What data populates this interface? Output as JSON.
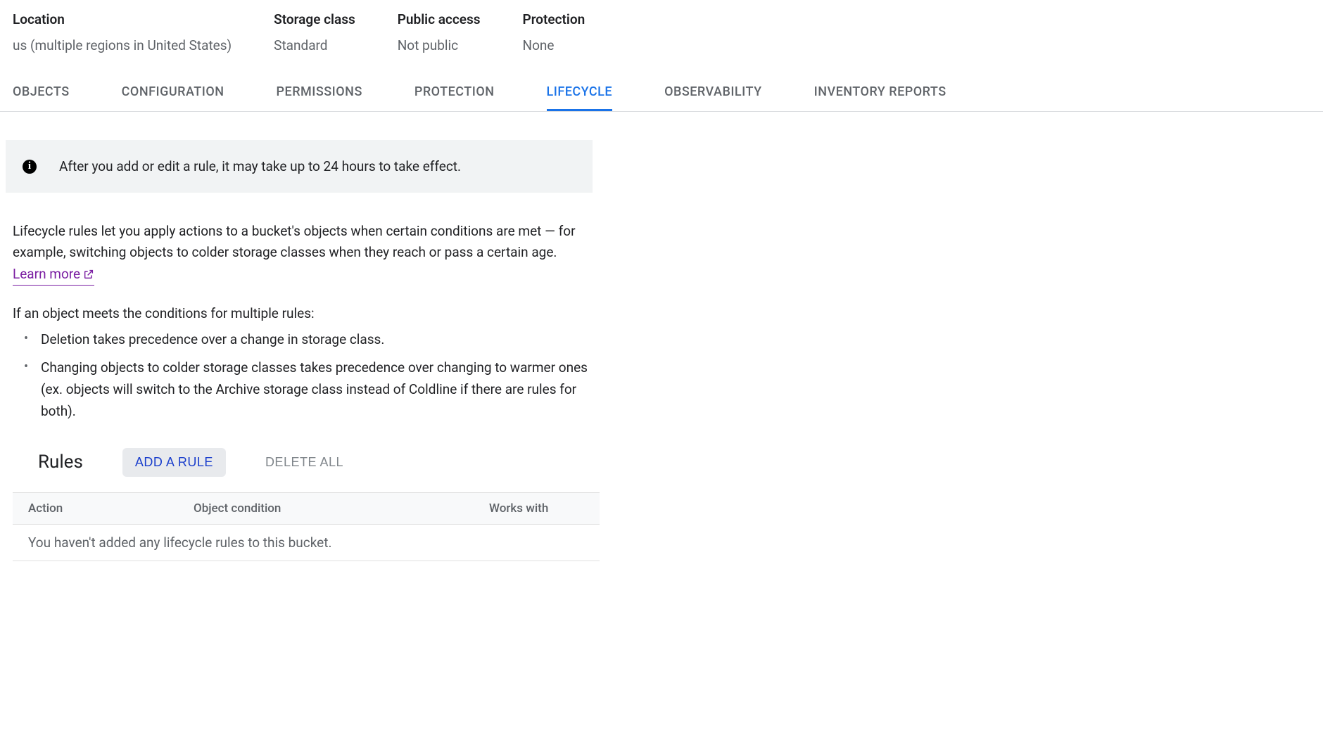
{
  "header": {
    "cols": [
      {
        "label": "Location",
        "value": "us (multiple regions in United States)"
      },
      {
        "label": "Storage class",
        "value": "Standard"
      },
      {
        "label": "Public access",
        "value": "Not public"
      },
      {
        "label": "Protection",
        "value": "None"
      }
    ]
  },
  "tabs": [
    {
      "label": "OBJECTS",
      "active": false
    },
    {
      "label": "CONFIGURATION",
      "active": false
    },
    {
      "label": "PERMISSIONS",
      "active": false
    },
    {
      "label": "PROTECTION",
      "active": false
    },
    {
      "label": "LIFECYCLE",
      "active": true
    },
    {
      "label": "OBSERVABILITY",
      "active": false
    },
    {
      "label": "INVENTORY REPORTS",
      "active": false
    }
  ],
  "banner": {
    "text": "After you add or edit a rule, it may take up to 24 hours to take effect."
  },
  "description": {
    "text": "Lifecycle rules let you apply actions to a bucket's objects when certain conditions are met — for example, switching objects to colder storage classes when they reach or pass a certain age. ",
    "learn_more": "Learn more"
  },
  "precedence": {
    "intro": "If an object meets the conditions for multiple rules:",
    "items": [
      "Deletion takes precedence over a change in storage class.",
      "Changing objects to colder storage classes takes precedence over changing to warmer ones (ex. objects will switch to the Archive storage class instead of Coldline if there are rules for both)."
    ]
  },
  "rules": {
    "title": "Rules",
    "add_label": "ADD A RULE",
    "delete_label": "DELETE ALL",
    "columns": {
      "action": "Action",
      "condition": "Object condition",
      "works": "Works with"
    },
    "empty_text": "You haven't added any lifecycle rules to this bucket."
  }
}
